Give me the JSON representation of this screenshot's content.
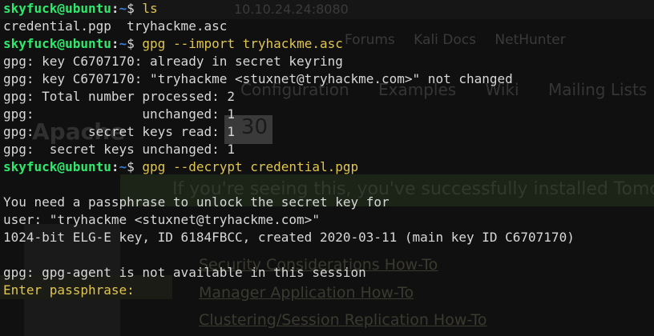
{
  "background_page": {
    "url_fragment": "10.10.24.24:8080",
    "bookmarks": [
      "Forums",
      "Kali Docs",
      "NetHunter"
    ],
    "nav": [
      "Configuration",
      "Examples",
      "Wiki",
      "Mailing Lists"
    ],
    "brand": "Apache",
    "version": "30",
    "banner": "If you're seeing this, you've successfully installed Tomcat",
    "links": [
      "Security Considerations How-To",
      "Manager Application How-To",
      "Clustering/Session Replication How-To"
    ]
  },
  "prompt": {
    "user_host": "skyfuck@ubuntu",
    "colon": ":",
    "path": "~",
    "dollar": "$ "
  },
  "lines": [
    {
      "type": "prompt",
      "cmd": "ls"
    },
    {
      "type": "output",
      "text": "credential.pgp  tryhackme.asc"
    },
    {
      "type": "prompt",
      "cmd": "gpg --import tryhackme.asc"
    },
    {
      "type": "output",
      "text": "gpg: key C6707170: already in secret keyring"
    },
    {
      "type": "output",
      "text": "gpg: key C6707170: \"tryhackme <stuxnet@tryhackme.com>\" not changed"
    },
    {
      "type": "output",
      "text": "gpg: Total number processed: 2"
    },
    {
      "type": "output",
      "text": "gpg:              unchanged: 1"
    },
    {
      "type": "output",
      "text": "gpg:       secret keys read: 1"
    },
    {
      "type": "output",
      "text": "gpg:  secret keys unchanged: 1"
    },
    {
      "type": "prompt",
      "cmd": "gpg --decrypt credential.pgp"
    },
    {
      "type": "output",
      "text": ""
    },
    {
      "type": "output",
      "text": "You need a passphrase to unlock the secret key for"
    },
    {
      "type": "output",
      "text": "user: \"tryhackme <stuxnet@tryhackme.com>\""
    },
    {
      "type": "output",
      "text": "1024-bit ELG-E key, ID 6184FBCC, created 2020-03-11 (main key ID C6707170)"
    },
    {
      "type": "output",
      "text": ""
    },
    {
      "type": "output",
      "text": "gpg: gpg-agent is not available in this session"
    },
    {
      "type": "input_prompt",
      "text": "Enter passphrase: "
    }
  ]
}
